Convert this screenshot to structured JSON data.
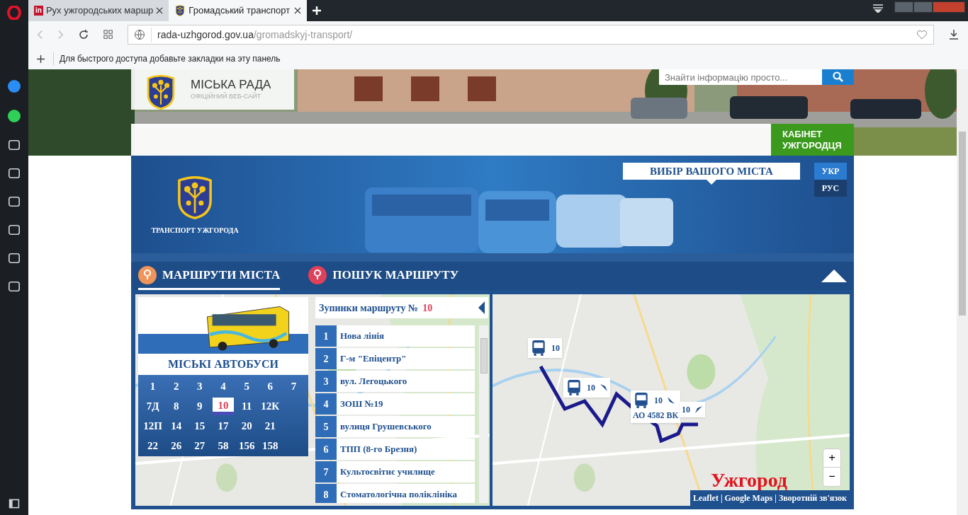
{
  "browser": {
    "tabs": [
      {
        "title": "Рух ужгородських маршр",
        "selected": false,
        "icon": "in"
      },
      {
        "title": "Громадський транспорт",
        "selected": true
      }
    ],
    "url_host": "rada-uzhgorod.gov.ua",
    "url_path": "/gromadskyj-transport/",
    "bookmarks_hint": "Для быстрого доступа добавьте закладки на эту панель"
  },
  "site": {
    "org_name": "МІСЬКА РАДА",
    "org_subtitle": "ОФІЦІЙНИЙ ВЕБ-САЙТ",
    "search": {
      "placeholder": "Знайти інформацію просто..."
    },
    "cabinet_button": "КАБІНЕТ УЖГОРОДЦЯ"
  },
  "transport": {
    "logo_caption": "ТРАНСПОРТ УЖГОРОДА",
    "city_select": "ВИБІР ВАШОГО МІСТА",
    "languages": [
      {
        "label": "УКР",
        "selected": true
      },
      {
        "label": "РУС",
        "selected": false
      }
    ],
    "tabs": [
      {
        "label": "МАРШРУТИ МІСТА",
        "selected": true
      },
      {
        "label": "ПОШУК МАРШРУТУ",
        "selected": false
      }
    ],
    "bus_card_title": "МІСЬКІ АВТОБУСИ",
    "route_rows": [
      [
        {
          "label": "1",
          "selected": false
        },
        {
          "label": "2",
          "selected": false
        },
        {
          "label": "3",
          "selected": false
        },
        {
          "label": "4",
          "selected": false
        },
        {
          "label": "5",
          "selected": false
        },
        {
          "label": "6",
          "selected": false
        },
        {
          "label": "7",
          "selected": false
        }
      ],
      [
        {
          "label": "7Д",
          "selected": false
        },
        {
          "label": "8",
          "selected": false
        },
        {
          "label": "9",
          "selected": false
        },
        {
          "label": "10",
          "selected": true
        },
        {
          "label": "11",
          "selected": false
        },
        {
          "label": "12К",
          "selected": false
        }
      ],
      [
        {
          "label": "12П",
          "selected": false
        },
        {
          "label": "14",
          "selected": false
        },
        {
          "label": "15",
          "selected": false
        },
        {
          "label": "17",
          "selected": false
        },
        {
          "label": "20",
          "selected": false
        },
        {
          "label": "21",
          "selected": false
        }
      ],
      [
        {
          "label": "22",
          "selected": false
        },
        {
          "label": "26",
          "selected": false
        },
        {
          "label": "27",
          "selected": false
        },
        {
          "label": "58",
          "selected": false
        },
        {
          "label": "156",
          "selected": false
        },
        {
          "label": "158",
          "selected": false
        }
      ]
    ],
    "stops_title": "Зупинки маршруту №",
    "stops_route": "10",
    "stops": [
      {
        "number": "1",
        "name": "Нова лінія"
      },
      {
        "number": "2",
        "name": "Г-м \"Епіцентр\""
      },
      {
        "number": "3",
        "name": "вул. Легоцького"
      },
      {
        "number": "4",
        "name": "ЗОШ №19"
      },
      {
        "number": "5",
        "name": "вулиця Грушевського"
      },
      {
        "number": "6",
        "name": "ТПП (8-го Брезня)"
      },
      {
        "number": "7",
        "name": "Культосвітнє училище"
      },
      {
        "number": "8",
        "name": "Стоматологічна поліклініка"
      }
    ],
    "map": {
      "markers": [
        {
          "kind": "bus",
          "route": "10"
        },
        {
          "kind": "bus-arrow",
          "route": "10"
        },
        {
          "kind": "bus-arrow",
          "route": "10",
          "plate": "АО 4582 ВК"
        },
        {
          "kind": "arrow",
          "route": "10"
        }
      ],
      "city_label": "Ужгород",
      "zoom_in": "+",
      "zoom_out": "−",
      "attribution": [
        {
          "kind": "link",
          "text": "Leaflet"
        },
        {
          "kind": "separator",
          "text": "|"
        },
        {
          "kind": "link",
          "text": "Google Maps"
        },
        {
          "kind": "separator",
          "text": "|"
        },
        {
          "kind": "link",
          "text": "Зворотній зв'язок"
        }
      ]
    }
  }
}
